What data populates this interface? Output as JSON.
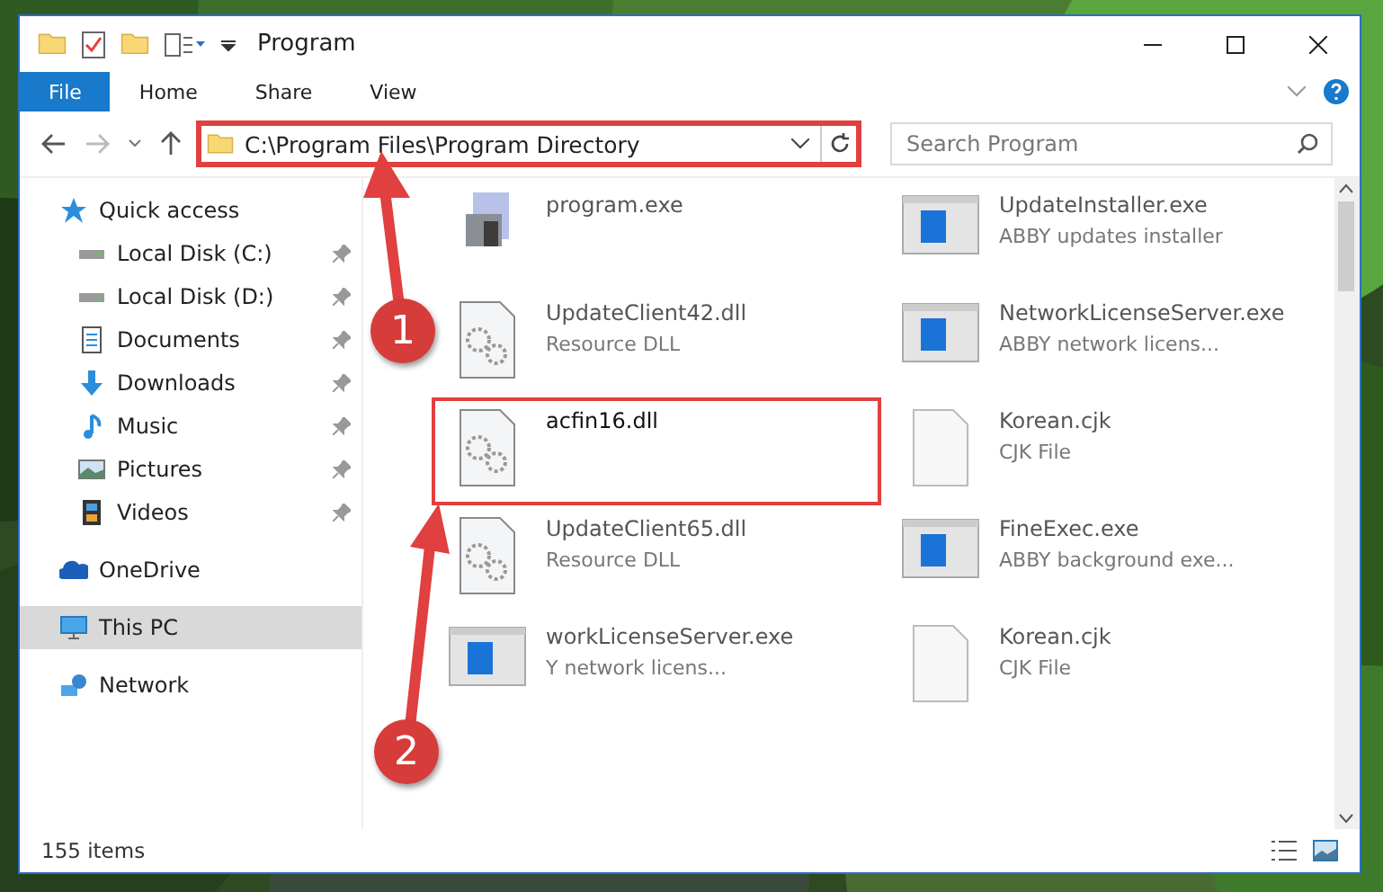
{
  "window": {
    "title": "Program"
  },
  "ribbon_tabs": [
    {
      "label": "File",
      "selected": true
    },
    {
      "label": "Home",
      "selected": false
    },
    {
      "label": "Share",
      "selected": false
    },
    {
      "label": "View",
      "selected": false
    }
  ],
  "address": {
    "path": "C:\\Program Files\\Program Directory",
    "highlighted": true
  },
  "search": {
    "placeholder": "Search Program"
  },
  "sidebar": {
    "items": [
      {
        "label": "Quick access",
        "kind": "star",
        "selected": false,
        "children": [
          {
            "label": "Local Disk (C:)",
            "kind": "disk",
            "pinned": true,
            "selected": false
          },
          {
            "label": "Local Disk (D:)",
            "kind": "disk",
            "pinned": true,
            "selected": false
          },
          {
            "label": "Documents",
            "kind": "document",
            "pinned": true,
            "selected": false
          },
          {
            "label": "Downloads",
            "kind": "download",
            "pinned": true,
            "selected": false
          },
          {
            "label": "Music",
            "kind": "music",
            "pinned": true,
            "selected": false
          },
          {
            "label": "Pictures",
            "kind": "picture",
            "pinned": true,
            "selected": false
          },
          {
            "label": "Videos",
            "kind": "video",
            "pinned": true,
            "selected": false
          }
        ]
      },
      {
        "label": "OneDrive",
        "kind": "cloud",
        "selected": false
      },
      {
        "label": "This PC",
        "kind": "pc",
        "selected": true
      },
      {
        "label": "Network",
        "kind": "network",
        "selected": false
      }
    ]
  },
  "files": [
    {
      "name": "program.exe",
      "kind": "setup",
      "highlighted": false
    },
    {
      "name": "UpdateInstaller.exe",
      "type": "ABBY updates installer",
      "kind": "app",
      "highlighted": false
    },
    {
      "name": "UpdateClient42.dll",
      "type": "Resource DLL",
      "kind": "dll",
      "highlighted": false
    },
    {
      "name": "NetworkLicenseServer.exe",
      "type": "ABBY network licens...",
      "kind": "app",
      "highlighted": false
    },
    {
      "name": "acfin16.dll",
      "kind": "dll",
      "highlighted": true
    },
    {
      "name": "Korean.cjk",
      "type": "CJK File",
      "kind": "blank",
      "highlighted": false
    },
    {
      "name": "UpdateClient65.dll",
      "type": "Resource DLL",
      "kind": "dll",
      "highlighted": false
    },
    {
      "name": "FineExec.exe",
      "type": "ABBY background exe...",
      "kind": "app",
      "highlighted": false
    },
    {
      "name": "workLicenseServer.exe",
      "type": "Y network licens...",
      "kind": "app",
      "highlighted": false
    },
    {
      "name": "Korean.cjk",
      "type": "CJK File",
      "kind": "blank",
      "highlighted": false
    }
  ],
  "status_bar": {
    "count": "155 items"
  },
  "annotations": [
    {
      "number": "1"
    },
    {
      "number": "2"
    }
  ]
}
